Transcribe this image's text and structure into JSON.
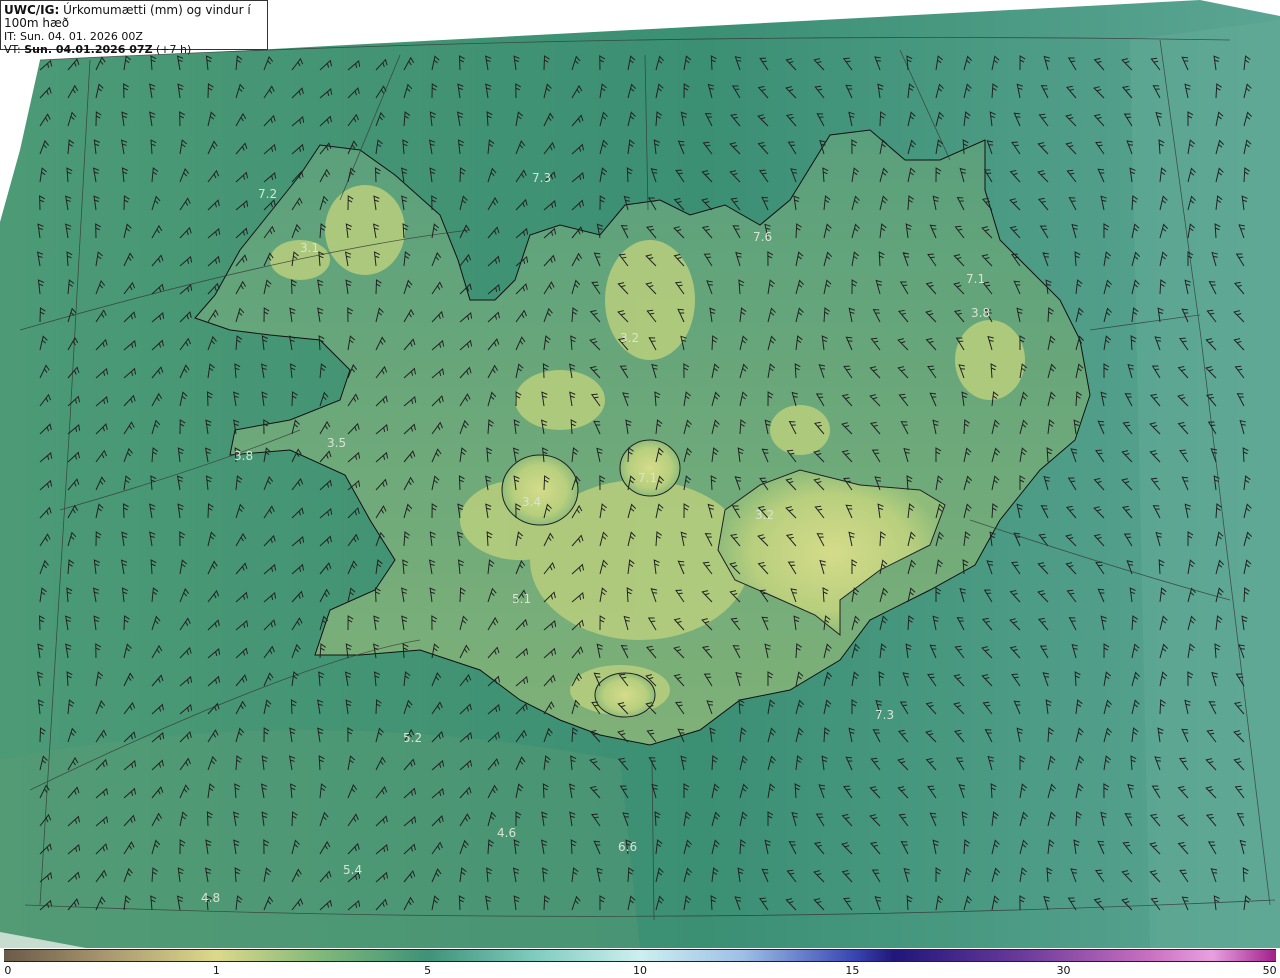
{
  "header": {
    "model": "UWC/IG:",
    "title": "Úrkomumætti (mm) og vindur í 100m hæð",
    "it_label": "IT: Sun. 04. 01. 2026 00Z",
    "vt_prefix": "VT:",
    "vt_value": "Sun. 04.01.2026 07Z",
    "vt_suffix": "(+7 h)"
  },
  "map_values": [
    "7.2",
    "3.1",
    "7.3",
    "7.6",
    "3.2",
    "7.1",
    "3.8",
    "3.5",
    "3.8",
    "3.4",
    "7.1",
    "3.2",
    "5.1",
    "5.2",
    "7.3",
    "4.6",
    "6.6",
    "5.4",
    "4.8"
  ],
  "colorbar": {
    "ticks": [
      "0",
      "1",
      "5",
      "10",
      "15",
      "30",
      "50"
    ],
    "tick_values": [
      0,
      1,
      5,
      10,
      15,
      30,
      50
    ]
  },
  "colors": {
    "sea": "#3e8f76",
    "land_low": "#4c9a6e",
    "land_high": "#c9d77f",
    "coast": "#111111"
  }
}
